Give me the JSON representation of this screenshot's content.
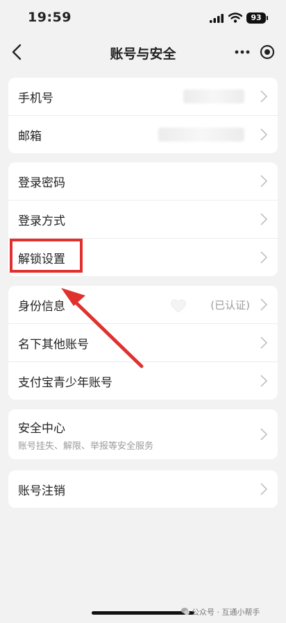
{
  "status_bar": {
    "time": "19:59",
    "battery": "93"
  },
  "nav": {
    "title": "账号与安全"
  },
  "groups": [
    {
      "items": [
        {
          "label": "手机号"
        },
        {
          "label": "邮箱"
        }
      ]
    },
    {
      "items": [
        {
          "label": "登录密码"
        },
        {
          "label": "登录方式"
        },
        {
          "label": "解锁设置"
        }
      ]
    },
    {
      "items": [
        {
          "label": "身份信息",
          "status": "(已认证)"
        },
        {
          "label": "名下其他账号"
        },
        {
          "label": "支付宝青少年账号"
        }
      ]
    },
    {
      "items": [
        {
          "label": "安全中心",
          "subtitle": "账号挂失、解限、举报等安全服务"
        }
      ]
    },
    {
      "items": [
        {
          "label": "账号注销"
        }
      ]
    }
  ],
  "annotation": {
    "highlight_color": "#e0312f"
  },
  "watermark": {
    "text": "公众号 · 互通小帮手"
  }
}
